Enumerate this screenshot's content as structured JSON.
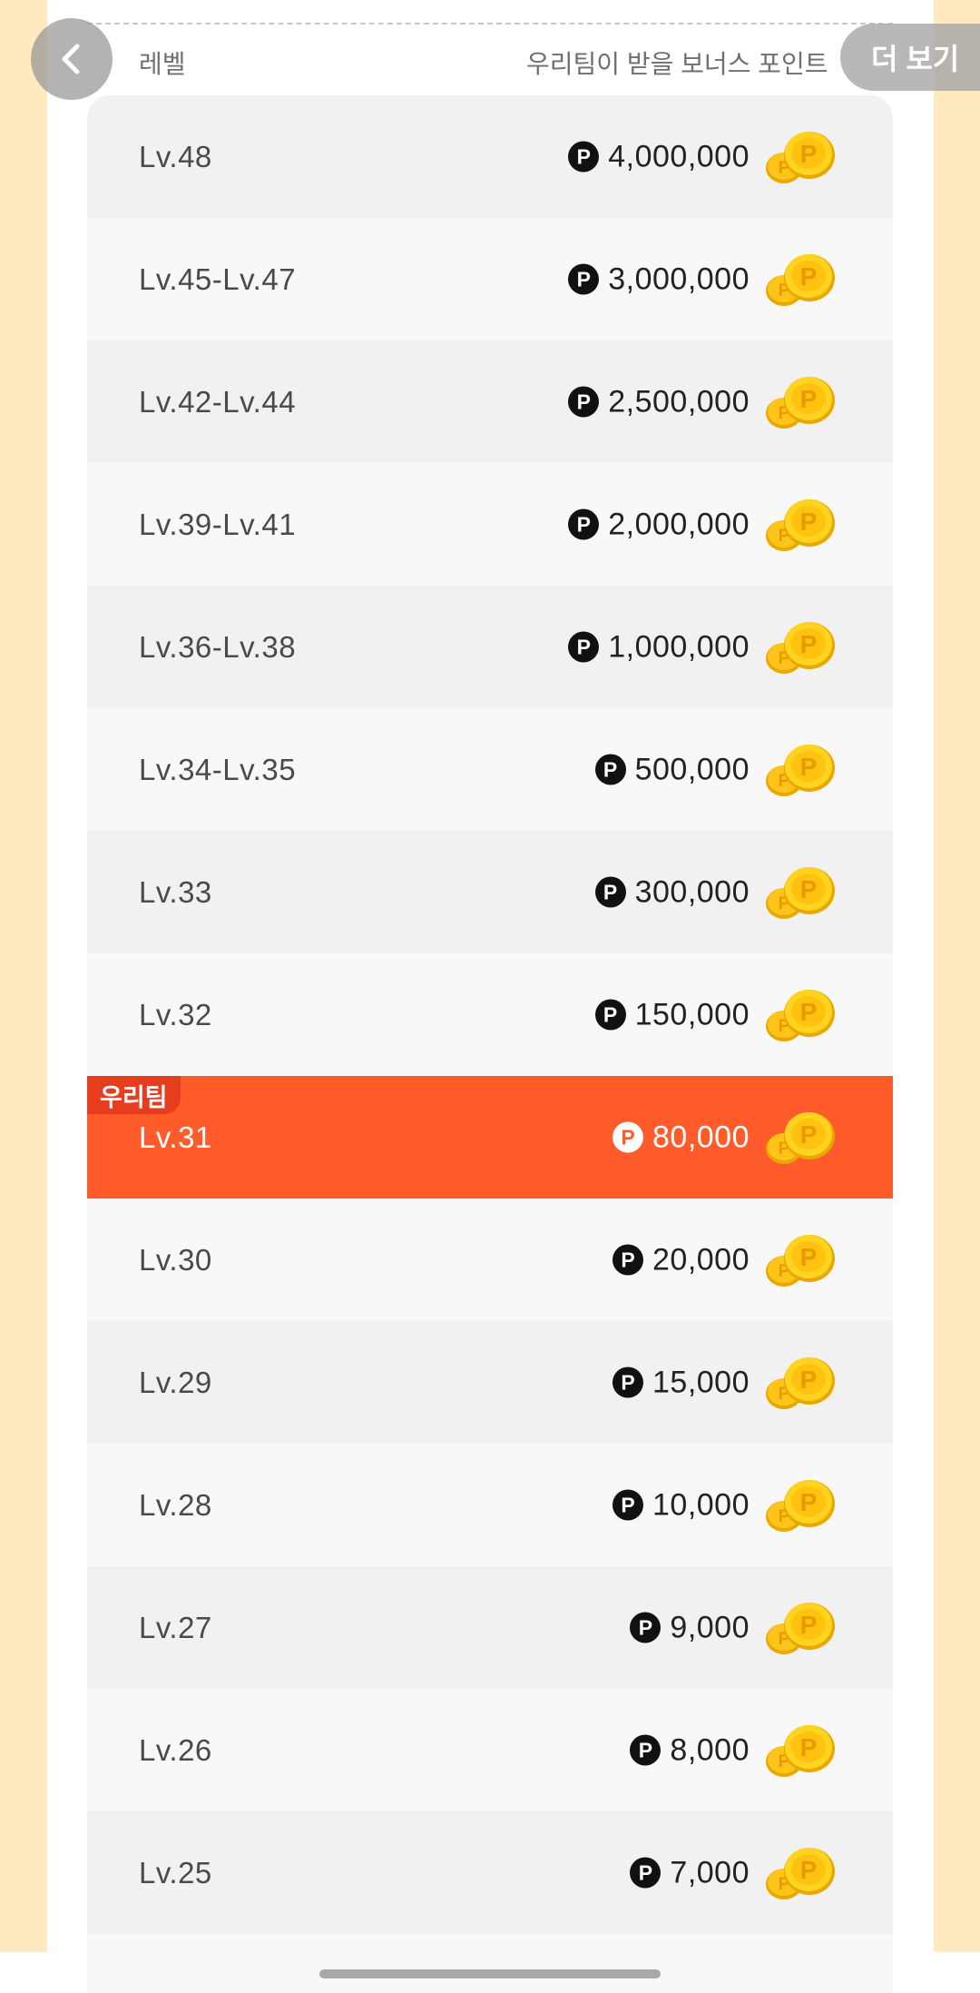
{
  "header": {
    "level_label": "레벨",
    "bonus_label": "우리팀이 받을 보너스 포인트",
    "more_label": "더 보기"
  },
  "icons": {
    "back": "chevron-left-icon",
    "point": "point-badge-icon",
    "coins": "coins-icon"
  },
  "colors": {
    "accent": "#ff5b2b",
    "tag": "#e73c1e",
    "side": "#ffeabf"
  },
  "point_symbol": "P",
  "current_tag": "우리팀",
  "rows": [
    {
      "level": "Lv.48",
      "points": "4,000,000"
    },
    {
      "level": "Lv.45-Lv.47",
      "points": "3,000,000"
    },
    {
      "level": "Lv.42-Lv.44",
      "points": "2,500,000"
    },
    {
      "level": "Lv.39-Lv.41",
      "points": "2,000,000"
    },
    {
      "level": "Lv.36-Lv.38",
      "points": "1,000,000"
    },
    {
      "level": "Lv.34-Lv.35",
      "points": "500,000"
    },
    {
      "level": "Lv.33",
      "points": "300,000"
    },
    {
      "level": "Lv.32",
      "points": "150,000"
    },
    {
      "level": "Lv.31",
      "points": "80,000",
      "current": true
    },
    {
      "level": "Lv.30",
      "points": "20,000"
    },
    {
      "level": "Lv.29",
      "points": "15,000"
    },
    {
      "level": "Lv.28",
      "points": "10,000"
    },
    {
      "level": "Lv.27",
      "points": "9,000"
    },
    {
      "level": "Lv.26",
      "points": "8,000"
    },
    {
      "level": "Lv.25",
      "points": "7,000"
    },
    {
      "level": "",
      "points": ""
    }
  ]
}
